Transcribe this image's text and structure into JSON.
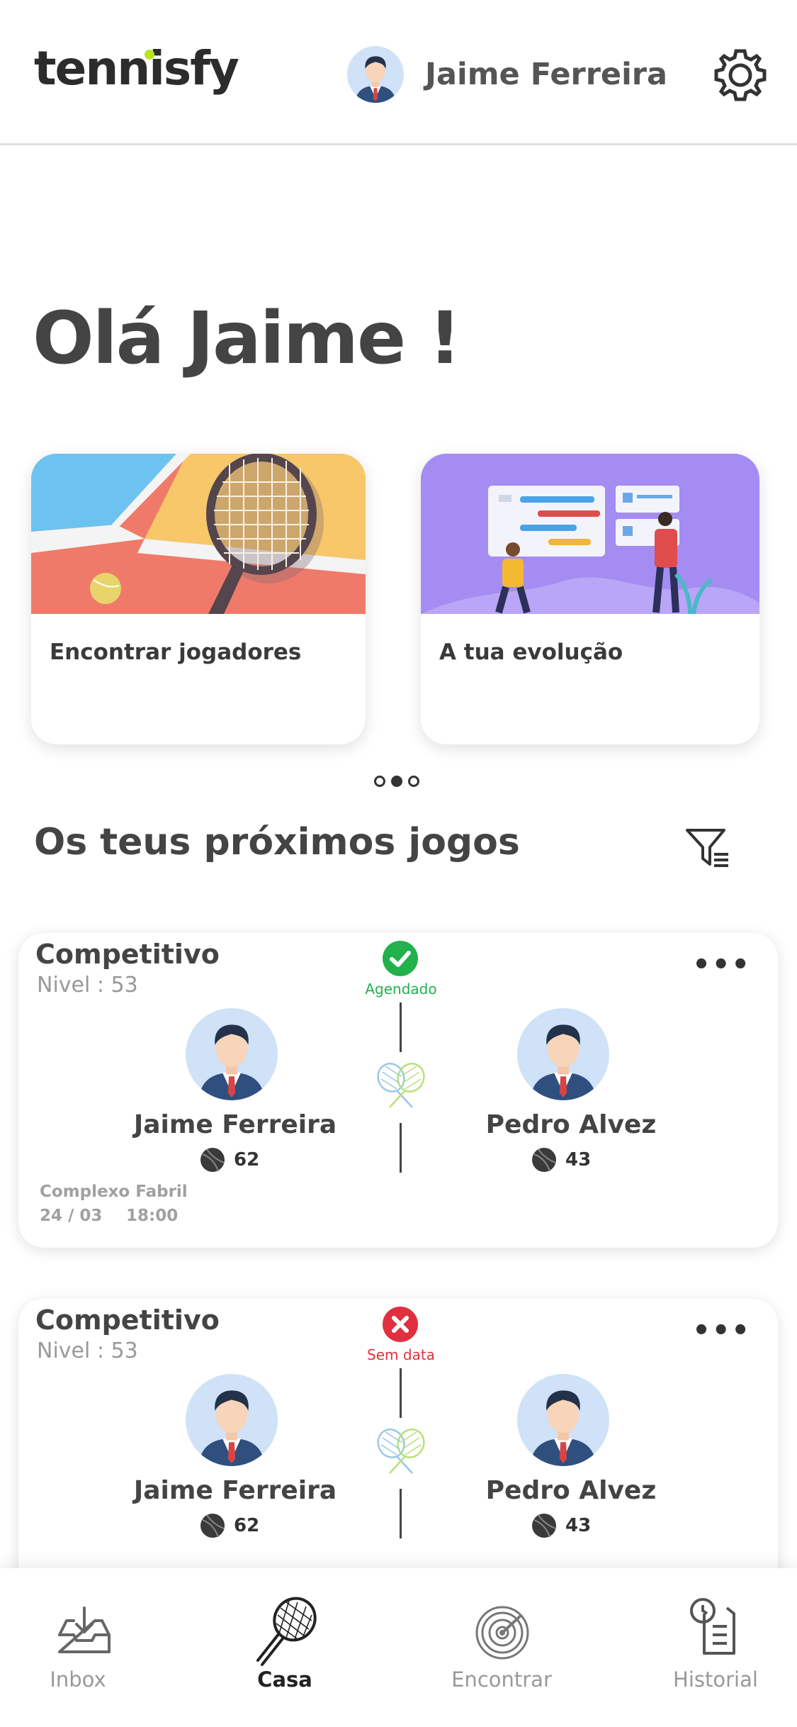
{
  "header": {
    "logo": "tennisfy",
    "user_name": "Jaime Ferreira"
  },
  "greeting": "Olá Jaime !",
  "feature_cards": [
    {
      "label": "Encontrar jogadores",
      "image": "tennis-racket-illustration"
    },
    {
      "label": "A tua evolução",
      "image": "evolution-dashboard-illustration"
    }
  ],
  "carousel": {
    "pages": 3,
    "active": 1
  },
  "section_title": "Os teus próximos jogos",
  "matches": [
    {
      "type": "Competitivo",
      "level": "Nivel : 53",
      "status": "Agendado",
      "status_color": "#22b14c",
      "player1": {
        "name": "Jaime Ferreira",
        "score": "62"
      },
      "player2": {
        "name": "Pedro Alvez",
        "score": "43"
      },
      "venue": "Complexo Fabril",
      "date": "24 / 03",
      "time": "18:00"
    },
    {
      "type": "Competitivo",
      "level": "Nivel : 53",
      "status": "Sem data",
      "status_color": "#e03040",
      "player1": {
        "name": "Jaime Ferreira",
        "score": "62"
      },
      "player2": {
        "name": "Pedro Alvez",
        "score": "43"
      }
    }
  ],
  "bottom_nav": [
    {
      "label": "Inbox",
      "icon": "inbox-icon"
    },
    {
      "label": "Casa",
      "icon": "tennis-racket-icon",
      "active": true
    },
    {
      "label": "Encontrar",
      "icon": "radar-icon"
    },
    {
      "label": "Historial",
      "icon": "history-icon"
    }
  ],
  "colors": {
    "accent_green": "#22b14c",
    "accent_red": "#e03040",
    "logo_dot": "#b5e61d"
  }
}
